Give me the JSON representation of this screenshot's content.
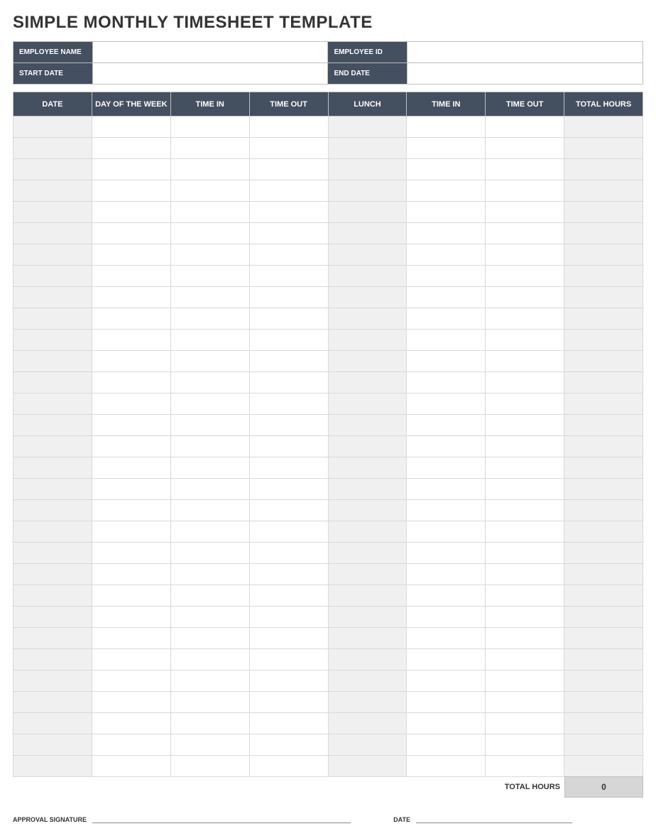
{
  "title": "SIMPLE MONTHLY TIMESHEET TEMPLATE",
  "info": {
    "employee_name_label": "EMPLOYEE NAME",
    "employee_name_value": "",
    "employee_id_label": "EMPLOYEE ID",
    "employee_id_value": "",
    "start_date_label": "START DATE",
    "start_date_value": "",
    "end_date_label": "END DATE",
    "end_date_value": ""
  },
  "columns": [
    "DATE",
    "DAY OF THE WEEK",
    "TIME IN",
    "TIME OUT",
    "LUNCH",
    "TIME IN",
    "TIME OUT",
    "TOTAL HOURS"
  ],
  "row_count": 31,
  "shaded_columns": [
    0,
    4,
    7
  ],
  "footer": {
    "total_label": "TOTAL HOURS",
    "total_value": "0"
  },
  "signature": {
    "approval_label": "APPROVAL SIGNATURE",
    "date_label": "DATE"
  }
}
